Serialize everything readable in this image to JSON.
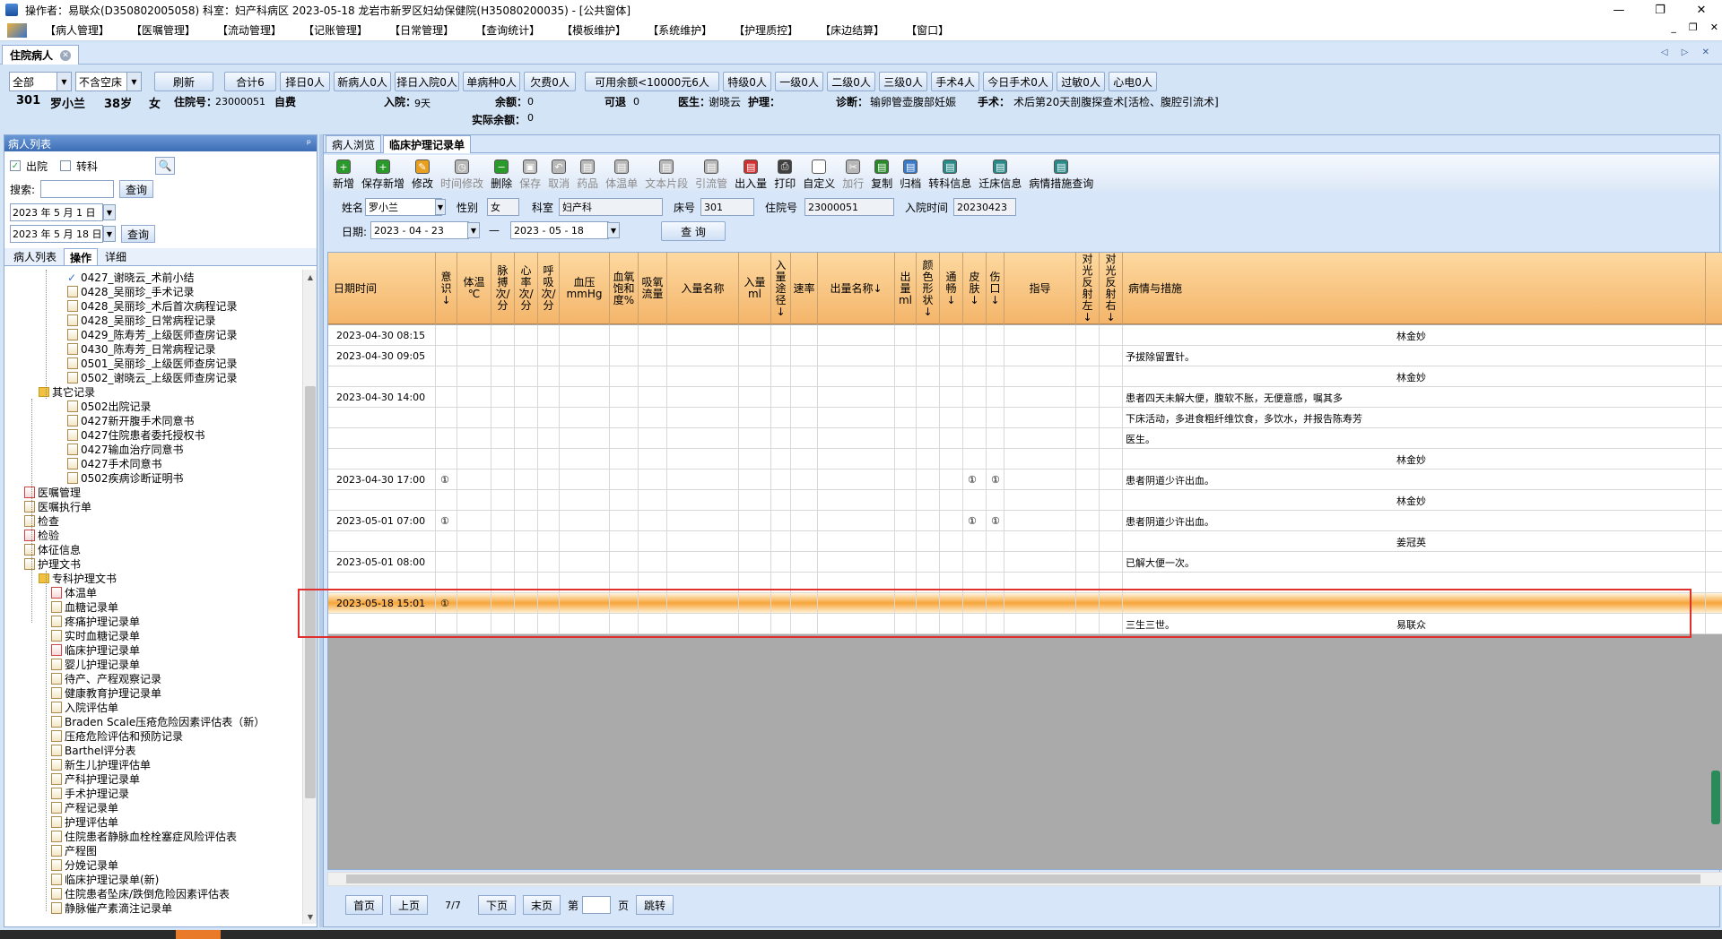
{
  "window": {
    "title": "操作者：易联众(D350802005058)  科室：妇产科病区  2023-05-18  龙岩市新罗区妇幼保健院(H35080200035) - [公共窗体]",
    "btn_min": "—",
    "btn_max": "❐",
    "btn_close": "✕"
  },
  "menu": [
    "【病人管理】",
    "【医嘱管理】",
    "【流动管理】",
    "【记账管理】",
    "【日常管理】",
    "【查询统计】",
    "【模板维护】",
    "【系统维护】",
    "【护理质控】",
    "【床边结算】",
    "【窗口】"
  ],
  "mdi_buttons": [
    "_",
    "❐",
    "✕"
  ],
  "main_tab": "住院病人",
  "tab_nav": "◁ ▷ ✕",
  "toolbar": {
    "scope": "全部",
    "bed": "不含空床",
    "buttons": [
      "刷新",
      "合计6",
      "择日0人",
      "新病人0人",
      "择日入院0人",
      "单病种0人",
      "欠费0人"
    ],
    "balance": "可用余额<10000元6人",
    "levels": [
      "特级0人",
      "一级0人",
      "二级0人",
      "三级0人",
      "手术4人",
      "今日手术0人",
      "过敏0人",
      "心电0人"
    ]
  },
  "patient": {
    "bed": "301",
    "name": "罗小兰",
    "age": "38岁",
    "sex": "女",
    "inpatient_label": "住院号：",
    "inpatient_no": "23000051",
    "payment": "自费",
    "admit_label": "入院：",
    "admit_days": "9天",
    "balance_label": "余额：",
    "balance": "0",
    "real_balance_label": "实际余额：",
    "real_balance": "0",
    "retreat_label": "可退",
    "retreat": "0",
    "doctor_label": "医生：",
    "doctor": "谢晓云",
    "nurse_label": "护理：",
    "diagnosis_label": "诊断：",
    "diagnosis": "输卵管壶腹部妊娠",
    "surgery_label": "手术：",
    "surgery": "术后第20天剖腹探查术[活检、腹腔引流术]"
  },
  "left": {
    "header": "病人列表",
    "pin": "ᵖ",
    "discharged": "出院",
    "transfer": "转科",
    "search_label": "搜索:",
    "query": "查询",
    "date_from": "2023 年 5 月 1 日",
    "date_to": "2023 年 5 月 18 日",
    "tabs": [
      "病人列表",
      "操作",
      "详细"
    ],
    "tree": [
      {
        "t": "0427_谢晓云_术前小结",
        "x": 70,
        "i": "check"
      },
      {
        "t": "0428_吴丽珍_手术记录",
        "x": 70,
        "i": "doc"
      },
      {
        "t": "0428_吴丽珍_术后首次病程记录",
        "x": 70,
        "i": "doc"
      },
      {
        "t": "0428_吴丽珍_日常病程记录",
        "x": 70,
        "i": "doc"
      },
      {
        "t": "0429_陈寿芳_上级医师查房记录",
        "x": 70,
        "i": "doc"
      },
      {
        "t": "0430_陈寿芳_日常病程记录",
        "x": 70,
        "i": "doc"
      },
      {
        "t": "0501_吴丽珍_上级医师查房记录",
        "x": 70,
        "i": "doc"
      },
      {
        "t": "0502_谢晓云_上级医师查房记录",
        "x": 70,
        "i": "doc"
      },
      {
        "t": "其它记录",
        "x": 38,
        "i": "folder"
      },
      {
        "t": "0502出院记录",
        "x": 70,
        "i": "doc"
      },
      {
        "t": "0427新开腹手术同意书",
        "x": 70,
        "i": "doc"
      },
      {
        "t": "0427住院患者委托授权书",
        "x": 70,
        "i": "doc"
      },
      {
        "t": "0427输血治疗同意书",
        "x": 70,
        "i": "doc"
      },
      {
        "t": "0427手术同意书",
        "x": 70,
        "i": "doc"
      },
      {
        "t": "0502疾病诊断证明书",
        "x": 70,
        "i": "doc"
      },
      {
        "t": "医嘱管理",
        "x": 22,
        "i": "red"
      },
      {
        "t": "医嘱执行单",
        "x": 22,
        "i": "doc"
      },
      {
        "t": "检查",
        "x": 22,
        "i": "doc"
      },
      {
        "t": "检验",
        "x": 22,
        "i": "red"
      },
      {
        "t": "体征信息",
        "x": 22,
        "i": "doc"
      },
      {
        "t": "护理文书",
        "x": 22,
        "i": "doc"
      },
      {
        "t": "专科护理文书",
        "x": 38,
        "i": "folder"
      },
      {
        "t": "体温单",
        "x": 52,
        "i": "red"
      },
      {
        "t": "血糖记录单",
        "x": 52,
        "i": "doc"
      },
      {
        "t": "疼痛护理记录单",
        "x": 52,
        "i": "doc"
      },
      {
        "t": "实时血糖记录单",
        "x": 52,
        "i": "doc"
      },
      {
        "t": "临床护理记录单",
        "x": 52,
        "i": "red"
      },
      {
        "t": "婴儿护理记录单",
        "x": 52,
        "i": "doc"
      },
      {
        "t": "待产、产程观察记录",
        "x": 52,
        "i": "doc"
      },
      {
        "t": "健康教育护理记录单",
        "x": 52,
        "i": "doc"
      },
      {
        "t": "入院评估单",
        "x": 52,
        "i": "doc"
      },
      {
        "t": "Braden Scale压疮危险因素评估表（新）",
        "x": 52,
        "i": "doc"
      },
      {
        "t": "压疮危险评估和预防记录",
        "x": 52,
        "i": "doc"
      },
      {
        "t": "Barthel评分表",
        "x": 52,
        "i": "doc"
      },
      {
        "t": "新生儿护理评估单",
        "x": 52,
        "i": "doc"
      },
      {
        "t": "产科护理记录单",
        "x": 52,
        "i": "doc"
      },
      {
        "t": "手术护理记录",
        "x": 52,
        "i": "doc"
      },
      {
        "t": "产程记录单",
        "x": 52,
        "i": "doc"
      },
      {
        "t": "护理评估单",
        "x": 52,
        "i": "doc"
      },
      {
        "t": "住院患者静脉血栓栓塞症风险评估表",
        "x": 52,
        "i": "doc"
      },
      {
        "t": "产程图",
        "x": 52,
        "i": "doc"
      },
      {
        "t": "分娩记录单",
        "x": 52,
        "i": "doc"
      },
      {
        "t": "临床护理记录单(新)",
        "x": 52,
        "i": "doc"
      },
      {
        "t": "住院患者坠床/跌倒危险因素评估表",
        "x": 52,
        "i": "doc"
      },
      {
        "t": "静脉催产素滴注记录单",
        "x": 52,
        "i": "doc"
      }
    ]
  },
  "right": {
    "tabs": [
      "病人浏览",
      "临床护理记录单"
    ],
    "icons": [
      {
        "l": "新增",
        "c": "#2a9a2a",
        "g": "+",
        "d": false
      },
      {
        "l": "保存新增",
        "c": "#2a9a2a",
        "g": "+",
        "d": false
      },
      {
        "l": "修改",
        "c": "#e8a020",
        "g": "✎",
        "d": false
      },
      {
        "l": "时间修改",
        "c": "#b8b8b8",
        "g": "◷",
        "d": true
      },
      {
        "l": "删除",
        "c": "#2a9a2a",
        "g": "−",
        "d": false
      },
      {
        "l": "保存",
        "c": "#b8b8b8",
        "g": "▣",
        "d": true
      },
      {
        "l": "取消",
        "c": "#b8b8b8",
        "g": "↶",
        "d": true
      },
      {
        "l": "药品",
        "c": "#b8b8b8",
        "g": "▤",
        "d": true
      },
      {
        "l": "体温单",
        "c": "#b8b8b8",
        "g": "▤",
        "d": true
      },
      {
        "l": "文本片段",
        "c": "#b8b8b8",
        "g": "▤",
        "d": true
      },
      {
        "l": "引流管",
        "c": "#b8b8b8",
        "g": "▤",
        "d": true
      },
      {
        "l": "出入量",
        "c": "#d03030",
        "g": "▤",
        "d": false
      },
      {
        "l": "打印",
        "c": "#404040",
        "g": "⎙",
        "d": false
      },
      {
        "l": "自定义",
        "c": "#ffffff",
        "g": "▯",
        "d": false
      },
      {
        "l": "加行",
        "c": "#b8b8b8",
        "g": "✂",
        "d": true
      },
      {
        "l": "复制",
        "c": "#2a8a2a",
        "g": "▤",
        "d": false
      },
      {
        "l": "归档",
        "c": "#3a7ac8",
        "g": "▤",
        "d": false
      },
      {
        "l": "转科信息",
        "c": "#2a8a8a",
        "g": "▤",
        "d": false
      },
      {
        "l": "迁床信息",
        "c": "#2a8a8a",
        "g": "▤",
        "d": false
      },
      {
        "l": "病情措施查询",
        "c": "#2a8a8a",
        "g": "▤",
        "d": false
      }
    ],
    "filter": {
      "name_label": "姓名",
      "name": "罗小兰",
      "sex_label": "性别",
      "sex": "女",
      "dept_label": "科室",
      "dept": "妇产科",
      "bed_label": "床号",
      "bed": "301",
      "inp_label": "住院号",
      "inp": "23000051",
      "admit_label": "入院时间",
      "admit": "20230423",
      "date_label": "日期:",
      "from": "2023 - 04 - 23",
      "dash": "—",
      "to": "2023 - 05 - 18",
      "query": "查 询"
    },
    "columns": [
      {
        "h": "日期时间",
        "w": 120
      },
      {
        "h": "意识↓",
        "w": 24
      },
      {
        "h": "体温 ℃",
        "w": 38
      },
      {
        "h": "脉搏 次/分",
        "w": 26
      },
      {
        "h": "心率 次/分",
        "w": 26
      },
      {
        "h": "呼吸 次/分",
        "w": 24
      },
      {
        "h": "血压 mmHg",
        "w": 56
      },
      {
        "h": "血氧饱和度%",
        "w": 32
      },
      {
        "h": "吸氧流量",
        "w": 32
      },
      {
        "h": "入量名称",
        "w": 80
      },
      {
        "h": "入量 ml",
        "w": 36
      },
      {
        "h": "入量途径↓",
        "w": 22
      },
      {
        "h": "速率",
        "w": 30
      },
      {
        "h": "出量名称↓",
        "w": 86
      },
      {
        "h": "出量 ml",
        "w": 24
      },
      {
        "h": "颜色形状↓",
        "w": 26
      },
      {
        "h": "通畅↓",
        "w": 26
      },
      {
        "h": "皮肤↓",
        "w": 26
      },
      {
        "h": "伤口↓",
        "w": 20
      },
      {
        "h": "指导",
        "w": 80
      },
      {
        "h": "对光反射左↓",
        "w": 26
      },
      {
        "h": "对光反射右↓",
        "w": 26
      },
      {
        "h": "病情与措施",
        "w": 650
      }
    ],
    "rows": [
      {
        "dt": "2023-04-30 08:15",
        "yi": "",
        "pf": "",
        "sk": "",
        "bq": "",
        "sig": "林金妙"
      },
      {
        "dt": "2023-04-30 09:05",
        "yi": "",
        "pf": "",
        "sk": "",
        "bq": "   予拔除留置针。",
        "sig": ""
      },
      {
        "dt": "",
        "yi": "",
        "pf": "",
        "sk": "",
        "bq": "",
        "sig": "林金妙"
      },
      {
        "dt": "2023-04-30 14:00",
        "yi": "",
        "pf": "",
        "sk": "",
        "bq": "   患者四天未解大便，腹软不胀，无便意感，嘱其多",
        "sig": ""
      },
      {
        "dt": "",
        "yi": "",
        "pf": "",
        "sk": "",
        "bq": "下床活动，多进食粗纤维饮食，多饮水，并报告陈寿芳",
        "sig": ""
      },
      {
        "dt": "",
        "yi": "",
        "pf": "",
        "sk": "",
        "bq": "医生。",
        "sig": ""
      },
      {
        "dt": "",
        "yi": "",
        "pf": "",
        "sk": "",
        "bq": "",
        "sig": "林金妙"
      },
      {
        "dt": "2023-04-30 17:00",
        "yi": "①",
        "pf": "①",
        "sk": "①",
        "bq": "   患者阴道少许出血。",
        "sig": ""
      },
      {
        "dt": "",
        "yi": "",
        "pf": "",
        "sk": "",
        "bq": "",
        "sig": "林金妙"
      },
      {
        "dt": "2023-05-01 07:00",
        "yi": "①",
        "pf": "①",
        "sk": "①",
        "bq": "   患者阴道少许出血。",
        "sig": ""
      },
      {
        "dt": "",
        "yi": "",
        "pf": "",
        "sk": "",
        "bq": "",
        "sig": "姜冠英"
      },
      {
        "dt": "2023-05-01 08:00",
        "yi": "",
        "pf": "",
        "sk": "",
        "bq": "   已解大便一次。",
        "sig": ""
      },
      {
        "dt": "",
        "yi": "",
        "pf": "",
        "sk": "",
        "bq": "",
        "sig": ""
      },
      {
        "dt": "2023-05-18 15:01",
        "yi": "①",
        "pf": "",
        "sk": "",
        "bq": "",
        "sig": ""
      },
      {
        "dt": "",
        "yi": "",
        "pf": "",
        "sk": "",
        "bq": "   三生三世。",
        "sig": "易联众"
      }
    ],
    "pager": {
      "first": "首页",
      "prev": "上页",
      "info": "7/7",
      "next": "下页",
      "last": "末页",
      "di": "第",
      "ye": "页",
      "go": "跳转"
    }
  }
}
